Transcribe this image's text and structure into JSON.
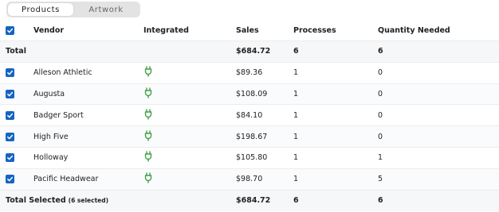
{
  "tabs": [
    {
      "label": "Products",
      "active": true
    },
    {
      "label": "Artwork",
      "active": false
    }
  ],
  "columns": {
    "vendor": "Vendor",
    "integrated": "Integrated",
    "sales": "Sales",
    "processes": "Processes",
    "quantity": "Quantity Needed"
  },
  "total": {
    "label": "Total",
    "sales": "$684.72",
    "processes": "6",
    "quantity": "6"
  },
  "rows": [
    {
      "vendor": "Alleson Athletic",
      "sales": "$89.36",
      "processes": "1",
      "quantity": "0",
      "integrated_icon": "plug-icon"
    },
    {
      "vendor": "Augusta",
      "sales": "$108.09",
      "processes": "1",
      "quantity": "0",
      "integrated_icon": "plug-icon"
    },
    {
      "vendor": "Badger Sport",
      "sales": "$84.10",
      "processes": "1",
      "quantity": "0",
      "integrated_icon": "plug-icon"
    },
    {
      "vendor": "High Five",
      "sales": "$198.67",
      "processes": "1",
      "quantity": "0",
      "integrated_icon": "plug-icon"
    },
    {
      "vendor": "Holloway",
      "sales": "$105.80",
      "processes": "1",
      "quantity": "1",
      "integrated_icon": "plug-icon"
    },
    {
      "vendor": "Pacific Headwear",
      "sales": "$98.70",
      "processes": "1",
      "quantity": "5",
      "integrated_icon": "plug-icon"
    }
  ],
  "footer": {
    "label": "Total Selected",
    "selected_count": "(6 selected)",
    "sales": "$684.72",
    "processes": "6",
    "quantity": "6"
  },
  "colors": {
    "checkbox": "#1565c0",
    "plug": "#43a047"
  }
}
